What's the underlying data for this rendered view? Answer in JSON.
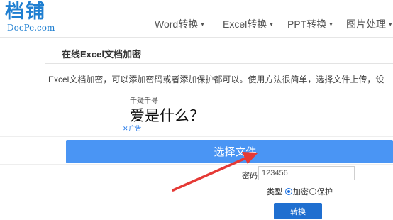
{
  "logo": {
    "main": "档铺",
    "sub": "DocPe.com"
  },
  "nav": {
    "items": [
      {
        "label": "Word转换"
      },
      {
        "label": "Excel转换"
      },
      {
        "label": "PPT转换"
      },
      {
        "label": "图片处理"
      }
    ]
  },
  "panel": {
    "title": "在线Excel文档加密",
    "description": "Excel文档加密，可以添加密码或者添加保护都可以。使用方法很简单，选择文件上传，设"
  },
  "ad": {
    "small_text": "千疑千寻",
    "title": "爱是什么？",
    "mark": "广告"
  },
  "upload": {
    "label": "选择文件"
  },
  "form": {
    "password_label": "密码",
    "password_value": "123456",
    "type_label": "类型",
    "option_encrypt": "加密",
    "option_protect": "保护",
    "selected": "加密"
  },
  "convert": {
    "label": "转换"
  },
  "annotation": {
    "color": "#e53935"
  },
  "colors": {
    "brand": "#1f7fd1",
    "upload_button": "#4a95f4",
    "convert_button": "#1f6fd0"
  }
}
